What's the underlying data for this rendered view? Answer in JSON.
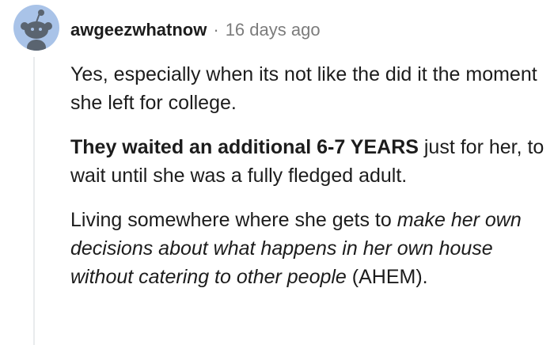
{
  "comment": {
    "author": "awgeezwhatnow",
    "separator": "·",
    "timestamp": "16 days ago",
    "avatar_icon": "snoo-avatar-icon",
    "colors": {
      "avatar_bg": "#a9c3e8",
      "thread_line": "#e9ebed",
      "meta_gray": "#7c7c7c",
      "text": "#1c1c1c"
    },
    "paragraphs": [
      {
        "text": "Yes, especially when its not like the did it the moment she left for college."
      },
      {
        "bold": "They waited an additional 6-7 YEARS",
        "text": " just for her, to wait until she was a fully fledged adult."
      },
      {
        "text": "Living somewhere where she gets to ",
        "italic": "make her own decisions about what happens in her own house without catering to other people",
        "tail": " (AHEM)."
      }
    ]
  }
}
